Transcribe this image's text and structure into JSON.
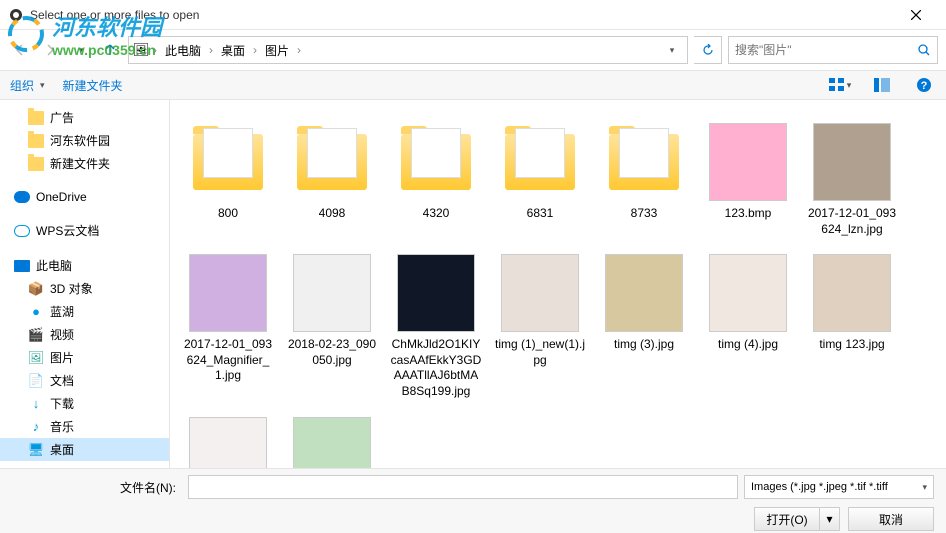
{
  "watermark": {
    "text": "河东软件园",
    "url": "www.pc0359.cn"
  },
  "title": "Select one or more files to open",
  "path": {
    "root": "此电脑",
    "desktop": "桌面",
    "folder": "图片"
  },
  "search": {
    "placeholder": "搜索\"图片\""
  },
  "toolbar": {
    "organize": "组织",
    "newfolder": "新建文件夹"
  },
  "sidebar": {
    "top_folders": [
      "广告",
      "河东软件园",
      "新建文件夹"
    ],
    "onedrive": "OneDrive",
    "wps": "WPS云文档",
    "thispc": "此电脑",
    "pc_items": [
      {
        "label": "3D 对象",
        "icon": "📦",
        "color": "#3cc"
      },
      {
        "label": "蓝湖",
        "icon": "●",
        "color": "#09e"
      },
      {
        "label": "视频",
        "icon": "🎬",
        "color": "#555"
      },
      {
        "label": "图片",
        "icon": "🖼",
        "color": "#3a9"
      },
      {
        "label": "文档",
        "icon": "📄",
        "color": "#555"
      },
      {
        "label": "下载",
        "icon": "↓",
        "color": "#09d"
      },
      {
        "label": "音乐",
        "icon": "♪",
        "color": "#09d"
      },
      {
        "label": "桌面",
        "icon": "🖥",
        "color": "#09d"
      }
    ]
  },
  "folders": [
    "800",
    "4098",
    "4320",
    "6831",
    "8733"
  ],
  "images": [
    {
      "name": "123.bmp",
      "bg": "#ffb0d0"
    },
    {
      "name": "2017-12-01_093624_lzn.jpg",
      "bg": "#b0a090"
    },
    {
      "name": "2017-12-01_093624_Magnifier_1.jpg",
      "bg": "#d0b0e0"
    },
    {
      "name": "2018-02-23_090050.jpg",
      "bg": "#f0f0f0"
    },
    {
      "name": "ChMkJld2O1KIYcasAAfEkkY3GDAAATllAJ6btMAB8Sq199.jpg",
      "bg": "#101828"
    },
    {
      "name": "timg (1)_new(1).jpg",
      "bg": "#e8e0d8"
    },
    {
      "name": "timg (3).jpg",
      "bg": "#d8c8a0"
    },
    {
      "name": "timg (4).jpg",
      "bg": "#f0e8e0"
    },
    {
      "name": "timg 123.jpg",
      "bg": "#e0d0c0"
    }
  ],
  "row3": [
    {
      "bg": "#f5f0f0"
    },
    {
      "bg": "#c0e0c0"
    }
  ],
  "bottom": {
    "filename_label": "文件名(N):",
    "filter": "Images (*.jpg *.jpeg *.tif *.tiff",
    "open": "打开(O)",
    "cancel": "取消"
  }
}
